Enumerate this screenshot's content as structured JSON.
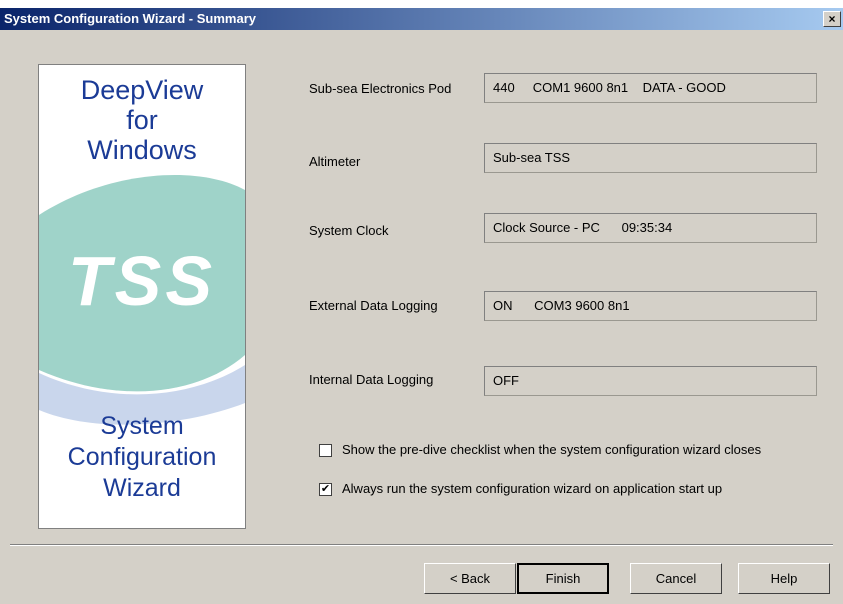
{
  "window": {
    "title": "System Configuration Wizard - Summary",
    "close_label": "×"
  },
  "banner": {
    "top_lines": [
      "DeepView",
      "for",
      "Windows"
    ],
    "logo_text": "TSS",
    "bottom_lines": [
      "System",
      "Configuration",
      "Wizard"
    ],
    "colors": {
      "text": "#1b3b96",
      "wave_green": "#9fd3c9",
      "wave_blue": "#c9d6ec"
    }
  },
  "fields": [
    {
      "label": "Sub-sea Electronics Pod",
      "value": "440     COM1 9600 8n1    DATA - GOOD"
    },
    {
      "label": "Altimeter",
      "value": "Sub-sea TSS"
    },
    {
      "label": "System Clock",
      "value": "Clock Source - PC      09:35:34"
    },
    {
      "label": "External Data Logging",
      "value": "ON      COM3 9600 8n1"
    },
    {
      "label": "Internal Data Logging",
      "value": "OFF"
    }
  ],
  "options": [
    {
      "label": "Show the pre-dive checklist when the system configuration wizard closes",
      "checked": false,
      "mark": ""
    },
    {
      "label": "Always run the system configuration wizard on application start up",
      "checked": true,
      "mark": "✔"
    }
  ],
  "buttons": {
    "back": "< Back",
    "finish": "Finish",
    "cancel": "Cancel",
    "help": "Help"
  }
}
